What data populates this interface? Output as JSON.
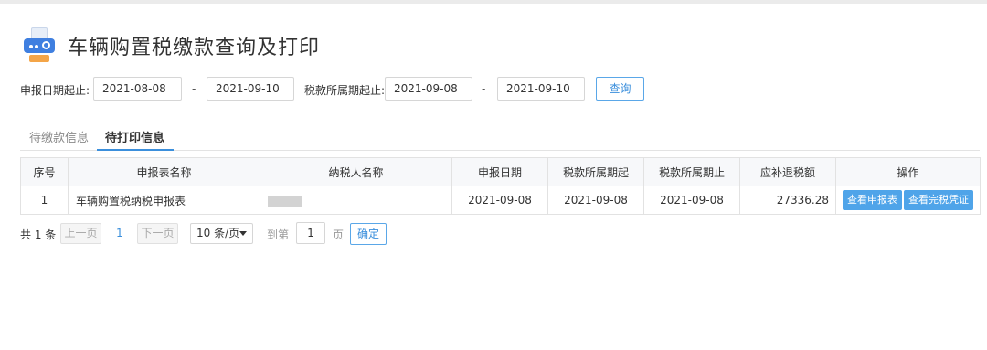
{
  "header": {
    "title": "车辆购置税缴款查询及打印",
    "icon": "printer-search-icon"
  },
  "filters": {
    "declare_label": "申报日期起止:",
    "declare_start": "2021-08-08",
    "declare_end": "2021-09-10",
    "tax_period_label": "税款所属期起止:",
    "tax_start": "2021-09-08",
    "tax_end": "2021-09-10",
    "separator": "-",
    "query_button": "查询"
  },
  "tabs": [
    {
      "label": "待缴款信息",
      "active": false
    },
    {
      "label": "待打印信息",
      "active": true
    }
  ],
  "table": {
    "headers": [
      "序号",
      "申报表名称",
      "纳税人名称",
      "申报日期",
      "税款所属期起",
      "税款所属期止",
      "应补退税额",
      "操作"
    ],
    "rows": [
      {
        "index": "1",
        "form_name": "车辆购置税纳税申报表",
        "taxpayer": "",
        "declare_date": "2021-09-08",
        "period_start": "2021-09-08",
        "period_end": "2021-09-08",
        "amount": "27336.28",
        "action_view_form": "查看申报表",
        "action_view_cert": "查看完税凭证"
      }
    ]
  },
  "pager": {
    "total": "共 1 条",
    "prev": "上一页",
    "current": "1",
    "next": "下一页",
    "page_size": "10 条/页",
    "goto_label": "到第",
    "goto_value": "1",
    "page_unit": "页",
    "confirm": "确定"
  },
  "colors": {
    "accent": "#3b8fdc",
    "button_fill": "#4fa4e9",
    "logo_blue": "#3f7fe0",
    "logo_orange": "#f4a548"
  }
}
